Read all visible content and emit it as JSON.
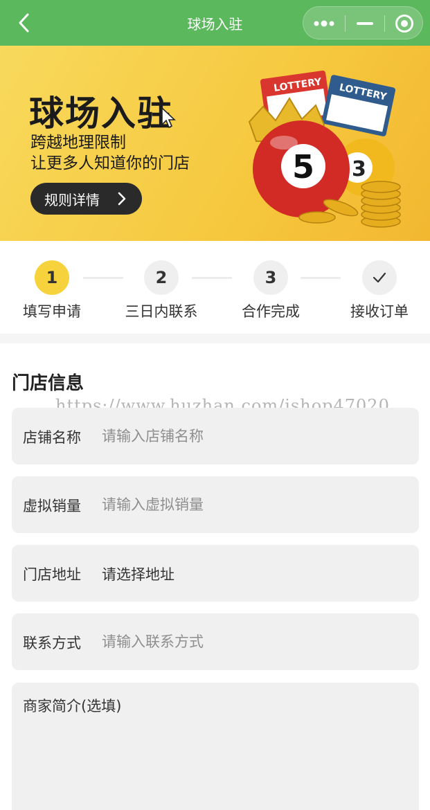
{
  "nav": {
    "title": "球场入驻",
    "back_icon": "chevron-left-icon",
    "capsule_icons": [
      "more-dots-icon",
      "minimize-icon",
      "close-target-icon"
    ],
    "bar_color": "#5cb85c"
  },
  "banner": {
    "title": "球场入驻",
    "line1": "跨越地理限制",
    "line2": "让更多人知道你的门店",
    "rules_button": "规则详情",
    "lottery_label_1": "LOTTERY",
    "lottery_label_2": "LOTTERY",
    "ball_number_1": "5",
    "ball_number_2": "3",
    "bg_color": "#f6c83e"
  },
  "steps": [
    {
      "marker": "1",
      "label": "填写申请",
      "active": true
    },
    {
      "marker": "2",
      "label": "三日内联系",
      "active": false
    },
    {
      "marker": "3",
      "label": "合作完成",
      "active": false
    },
    {
      "marker": "",
      "icon": "check-icon",
      "label": "接收订单",
      "active": false
    }
  ],
  "form": {
    "section_title": "门店信息",
    "watermark": "https://www.huzhan.com/ishop47020",
    "fields": [
      {
        "label": "店铺名称",
        "placeholder": "请输入店铺名称"
      },
      {
        "label": "虚拟销量",
        "placeholder": "请输入虚拟销量"
      },
      {
        "label": "门店地址",
        "value": "请选择地址"
      },
      {
        "label": "联系方式",
        "placeholder": "请输入联系方式"
      }
    ],
    "intro_label": "商家简介(选填)"
  }
}
